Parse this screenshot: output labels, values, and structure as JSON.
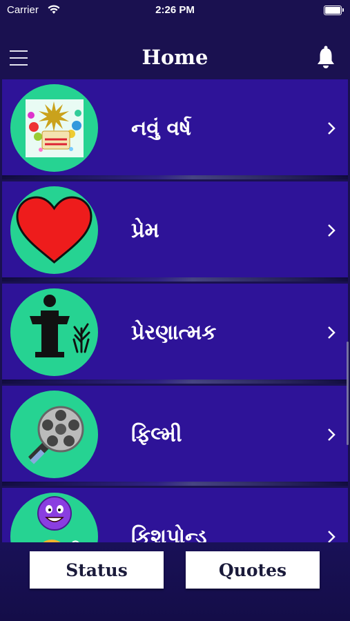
{
  "status_bar": {
    "carrier": "Carrier",
    "time": "2:26 PM"
  },
  "nav": {
    "title": "Home"
  },
  "categories": [
    {
      "label": "નવું વર્ષ",
      "icon": "new-year-icon"
    },
    {
      "label": "પ્રેમ",
      "icon": "heart-icon"
    },
    {
      "label": "પ્રેરણાત્મક",
      "icon": "speaker-podium-icon"
    },
    {
      "label": "ફિલ્મી",
      "icon": "film-reel-icon"
    },
    {
      "label": "કિશપોન્ડ",
      "icon": "emoji-faces-icon"
    }
  ],
  "bottom": {
    "status_label": "Status",
    "quotes_label": "Quotes"
  },
  "colors": {
    "row_bg": "#2e1398",
    "circle_bg": "#26d392",
    "page_bg": "#1a1150"
  }
}
